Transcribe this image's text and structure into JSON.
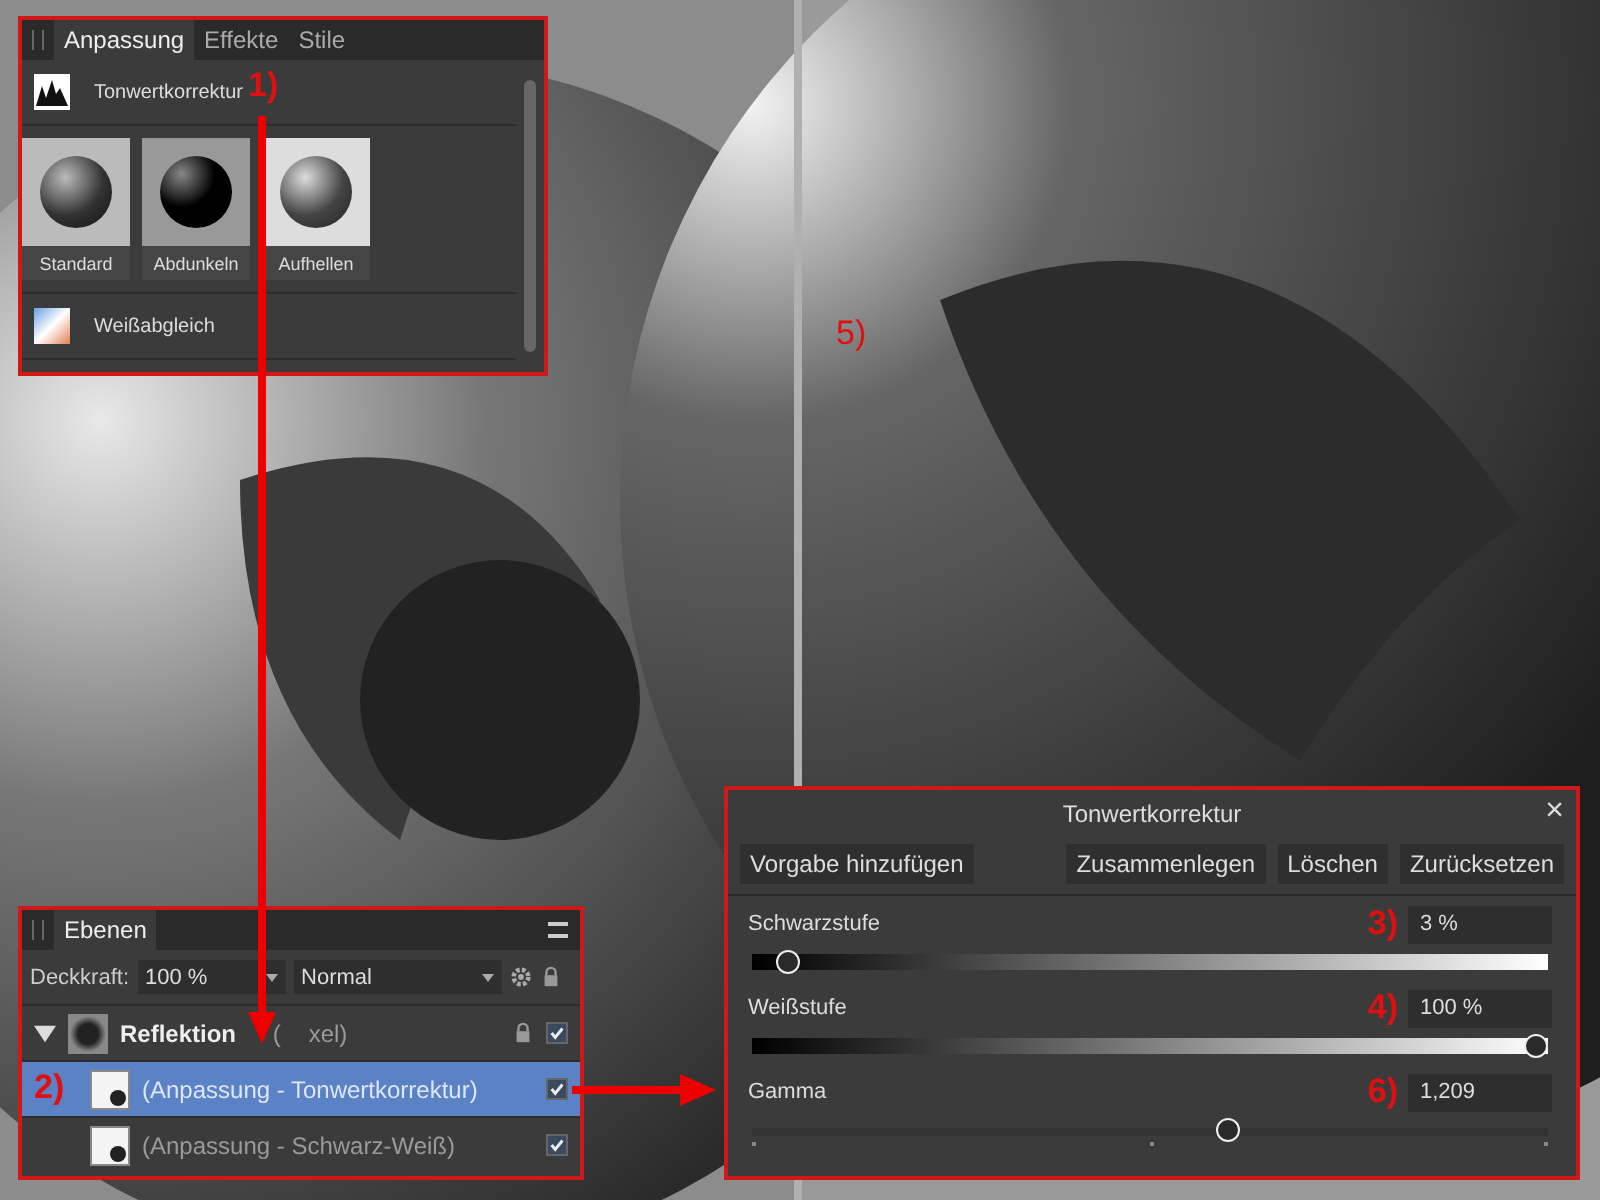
{
  "adjustments_panel": {
    "tabs": [
      {
        "label": "Anpassung",
        "selected": true
      },
      {
        "label": "Effekte",
        "selected": false
      },
      {
        "label": "Stile",
        "selected": false
      }
    ],
    "items": [
      {
        "kind": "histogram",
        "label": "Tonwertkorrektur"
      },
      {
        "kind": "presets",
        "presets": [
          {
            "label": "Standard"
          },
          {
            "label": "Abdunkeln"
          },
          {
            "label": "Aufhellen"
          }
        ]
      },
      {
        "kind": "whitebalance",
        "label": "Weißabgleich"
      }
    ]
  },
  "layers_panel": {
    "tab": "Ebenen",
    "opacity_label": "Deckkraft:",
    "opacity": "100 %",
    "blend_mode": "Normal",
    "layers": [
      {
        "name": "Reflektion",
        "type_start": "(",
        "type_end": "xel)",
        "expanded": true,
        "locked": true,
        "visible": true,
        "selected": false,
        "children": [
          {
            "name": "(Anpassung - Tonwertkorrektur)",
            "visible": true,
            "selected": true
          },
          {
            "name": "(Anpassung - Schwarz-Weiß)",
            "visible": true,
            "selected": false
          }
        ]
      }
    ]
  },
  "levels_dialog": {
    "title": "Tonwertkorrektur",
    "close": "×",
    "buttons": [
      "Vorgabe hinzufügen",
      "Zusammenlegen",
      "Löschen",
      "Zurücksetzen"
    ],
    "sliders": [
      {
        "kind": "gradient",
        "label": "Schwarzstufe",
        "marker": "3)",
        "value": "3 %",
        "level": 0.03
      },
      {
        "kind": "gradient",
        "label": "Weißstufe",
        "marker": "4)",
        "value": "100 %",
        "level": 1
      },
      {
        "kind": "ticks",
        "label": "Gamma",
        "marker": "6)",
        "value": "1,209",
        "level": 0.6
      }
    ]
  },
  "annotations": [
    "1)",
    "2)",
    "5)"
  ]
}
